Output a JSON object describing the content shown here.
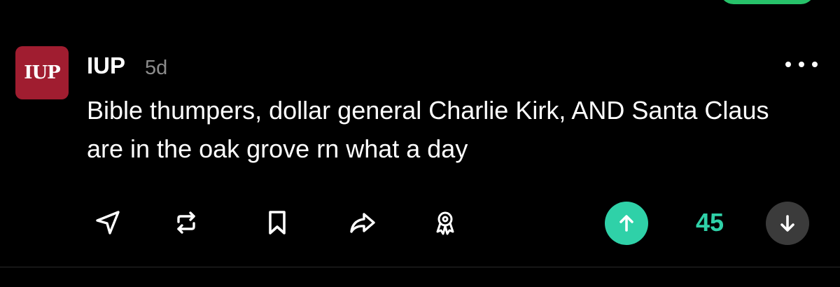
{
  "post": {
    "avatar_text": "IUP",
    "username": "IUP",
    "time": "5d",
    "text": "Bible thumpers, dollar general Charlie Kirk, AND Santa Claus are in the oak grove rn what a day",
    "vote_count": "45"
  },
  "actions": [
    "send-icon",
    "repost-icon",
    "bookmark-icon",
    "share-icon",
    "award-icon"
  ],
  "colors": {
    "background": "#000000",
    "avatar": "#a01d30",
    "upvote_accent": "#2fd1a8",
    "downvote_bg": "#3b3b3b",
    "time_text": "#8c8c8c"
  }
}
